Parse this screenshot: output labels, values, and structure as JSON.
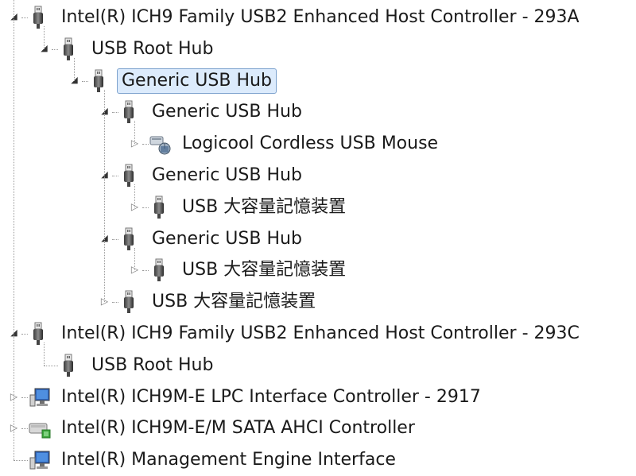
{
  "tree": {
    "nodes": [
      {
        "label": "Intel(R) ICH9 Family USB2 Enhanced Host Controller - 293A",
        "level": 0,
        "expander": "expanded",
        "icon": "usb-plug-icon"
      },
      {
        "label": "USB Root Hub",
        "level": 1,
        "expander": "expanded",
        "icon": "usb-plug-icon"
      },
      {
        "label": "Generic USB Hub",
        "level": 2,
        "expander": "expanded",
        "icon": "usb-plug-icon",
        "selected": true
      },
      {
        "label": "Generic USB Hub",
        "level": 3,
        "expander": "expanded",
        "icon": "usb-plug-icon"
      },
      {
        "label": "Logicool Cordless USB Mouse",
        "level": 4,
        "expander": "collapsed",
        "icon": "mouse-device-icon"
      },
      {
        "label": "Generic USB Hub",
        "level": 3,
        "expander": "expanded",
        "icon": "usb-plug-icon"
      },
      {
        "label": "USB 大容量記憶装置",
        "level": 4,
        "expander": "collapsed",
        "icon": "usb-plug-icon"
      },
      {
        "label": "Generic USB Hub",
        "level": 3,
        "expander": "expanded",
        "icon": "usb-plug-icon"
      },
      {
        "label": "USB 大容量記憶装置",
        "level": 4,
        "expander": "collapsed",
        "icon": "usb-plug-icon"
      },
      {
        "label": "USB 大容量記憶装置",
        "level": 3,
        "expander": "collapsed",
        "icon": "usb-plug-icon"
      },
      {
        "label": "Intel(R) ICH9 Family USB2 Enhanced Host Controller - 293C",
        "level": 0,
        "expander": "expanded",
        "icon": "usb-plug-icon"
      },
      {
        "label": "USB Root Hub",
        "level": 1,
        "expander": "none",
        "icon": "usb-plug-icon"
      },
      {
        "label": "Intel(R) ICH9M-E LPC Interface Controller - 2917",
        "level": 0,
        "expander": "collapsed",
        "icon": "monitor-device-icon"
      },
      {
        "label": "Intel(R) ICH9M-E/M SATA AHCI Controller",
        "level": 0,
        "expander": "collapsed",
        "icon": "drive-controller-icon"
      },
      {
        "label": "Intel(R) Management Engine Interface",
        "level": 0,
        "expander": "none",
        "icon": "monitor-device-icon"
      }
    ]
  },
  "glyphs": {
    "expanded": "◢",
    "collapsed": "▷"
  },
  "colors": {
    "selection_bg": "#dcebfc",
    "selection_border": "#7da2ce",
    "tree_lines": "#9a9a9a"
  }
}
